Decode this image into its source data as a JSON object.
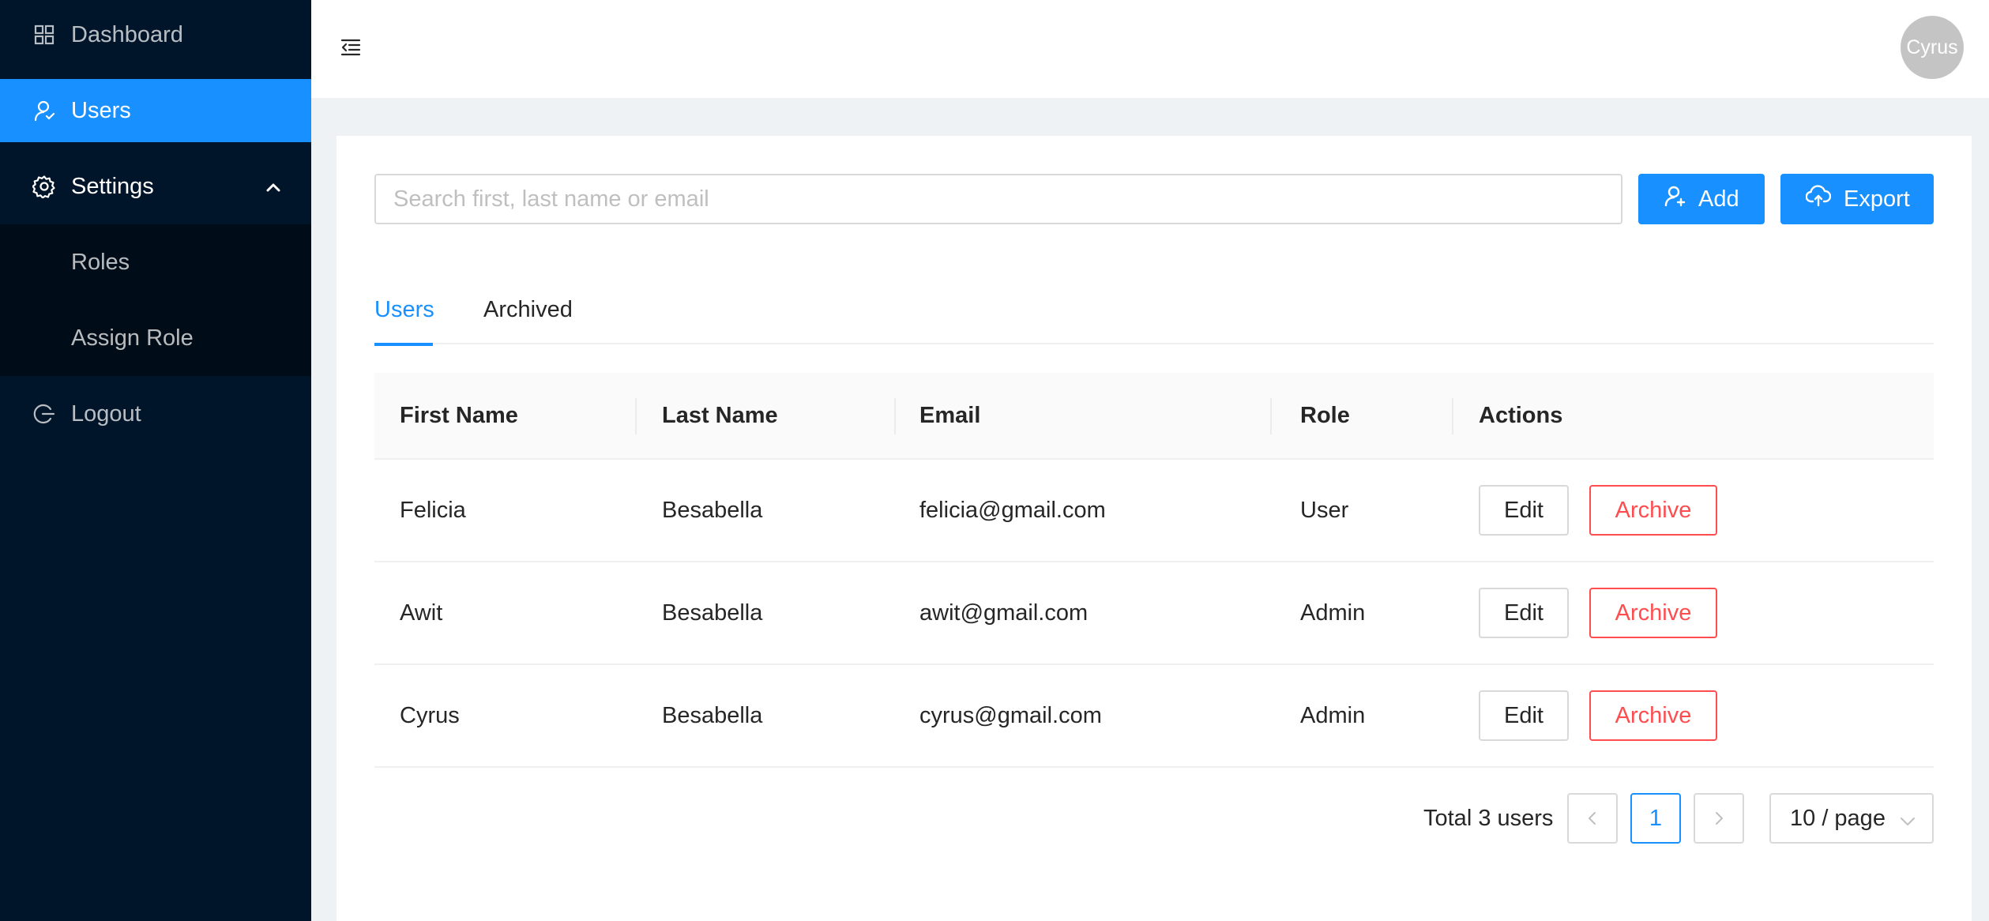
{
  "sidebar": {
    "items": [
      {
        "label": "Dashboard",
        "icon": "dashboard-icon"
      },
      {
        "label": "Users",
        "icon": "user-icon"
      },
      {
        "label": "Settings",
        "icon": "gear-icon"
      },
      {
        "label": "Logout",
        "icon": "logout-icon"
      }
    ],
    "submenu": [
      {
        "label": "Roles"
      },
      {
        "label": "Assign Role"
      }
    ]
  },
  "header": {
    "avatar_text": "Cyrus"
  },
  "toolbar": {
    "search_placeholder": "Search first, last name or email",
    "add_label": "Add",
    "export_label": "Export"
  },
  "tabs": [
    {
      "label": "Users",
      "active": true
    },
    {
      "label": "Archived",
      "active": false
    }
  ],
  "table": {
    "columns": [
      "First Name",
      "Last Name",
      "Email",
      "Role",
      "Actions"
    ],
    "rows": [
      {
        "first": "Felicia",
        "last": "Besabella",
        "email": "felicia@gmail.com",
        "role": "User"
      },
      {
        "first": "Awit",
        "last": "Besabella",
        "email": "awit@gmail.com",
        "role": "Admin"
      },
      {
        "first": "Cyrus",
        "last": "Besabella",
        "email": "cyrus@gmail.com",
        "role": "Admin"
      }
    ],
    "edit_label": "Edit",
    "archive_label": "Archive"
  },
  "pagination": {
    "total_text": "Total 3 users",
    "current_page": "1",
    "page_size": "10 / page"
  },
  "colors": {
    "primary": "#1890ff",
    "danger": "#ff4d4f",
    "sidebar_bg": "#001529"
  }
}
